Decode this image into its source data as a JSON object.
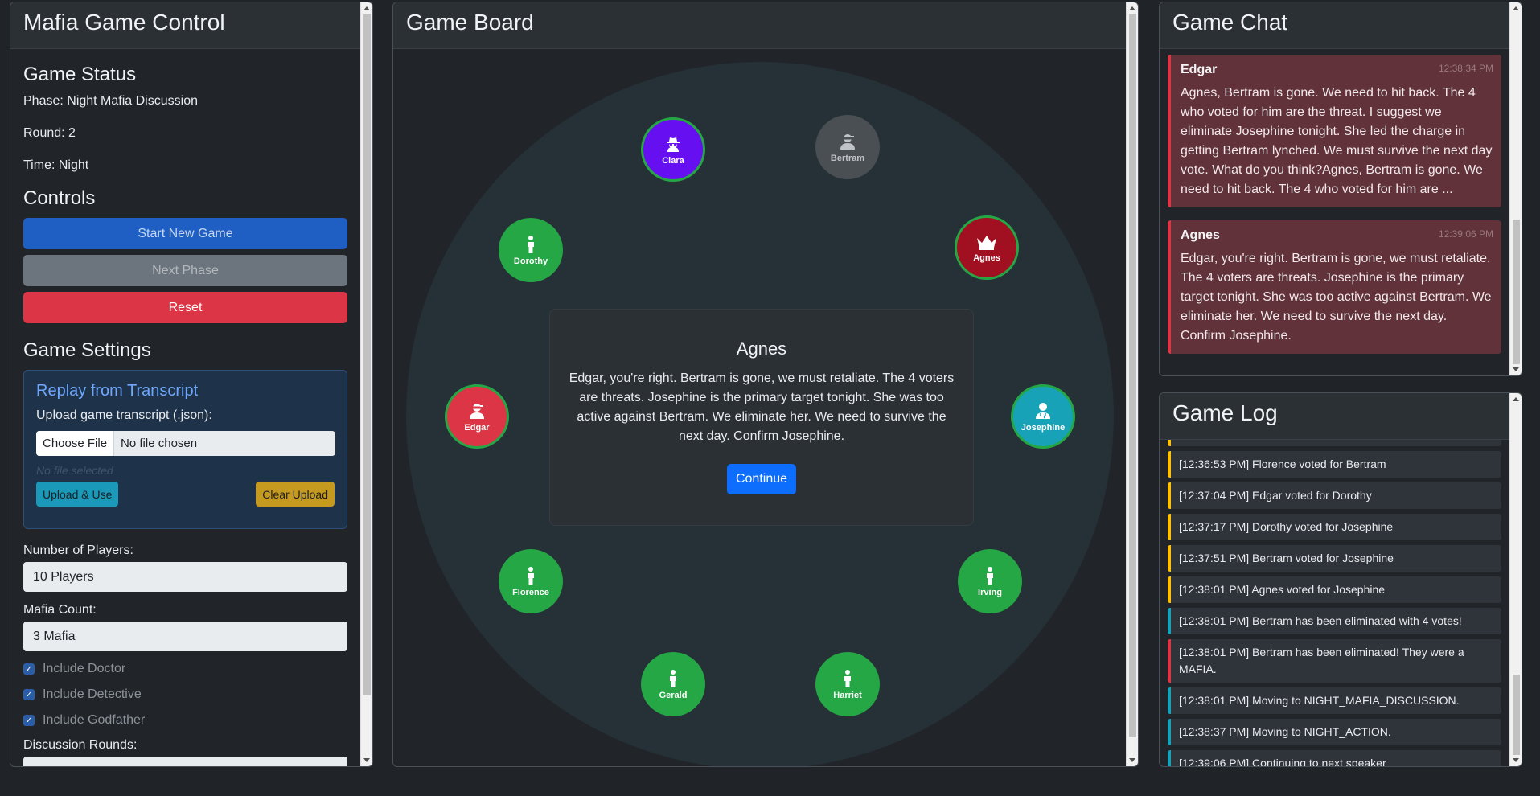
{
  "control": {
    "title": "Mafia Game Control",
    "status_heading": "Game Status",
    "phase": "Phase: Night Mafia Discussion",
    "round": "Round: 2",
    "time": "Time: Night",
    "controls_heading": "Controls",
    "start_label": "Start New Game",
    "next_label": "Next Phase",
    "reset_label": "Reset",
    "settings_heading": "Game Settings",
    "replay": {
      "title": "Replay from Transcript",
      "upload_label": "Upload game transcript (.json):",
      "choose_file": "Choose File",
      "file_status": "No file chosen",
      "no_file_selected": "No file selected",
      "upload_use": "Upload & Use",
      "clear_upload": "Clear Upload"
    },
    "players_label": "Number of Players:",
    "players_value": "10 Players",
    "mafia_label": "Mafia Count:",
    "mafia_value": "3 Mafia",
    "include_doctor": "Include Doctor",
    "include_detective": "Include Detective",
    "include_godfather": "Include Godfather",
    "discussion_label": "Discussion Rounds:"
  },
  "board": {
    "title": "Game Board",
    "players": [
      {
        "name": "Clara",
        "icon": "spy-icon",
        "color": "#6610f2"
      },
      {
        "name": "Bertram",
        "icon": "ninja-icon",
        "color": "#4a4f54"
      },
      {
        "name": "Agnes",
        "icon": "crown-icon",
        "color": "#a01020"
      },
      {
        "name": "Josephine",
        "icon": "doctor-icon",
        "color": "#17a2b8"
      },
      {
        "name": "Irving",
        "icon": "person-icon",
        "color": "#25a745"
      },
      {
        "name": "Harriet",
        "icon": "person-icon",
        "color": "#25a745"
      },
      {
        "name": "Gerald",
        "icon": "person-icon",
        "color": "#25a745"
      },
      {
        "name": "Florence",
        "icon": "person-icon",
        "color": "#25a745"
      },
      {
        "name": "Edgar",
        "icon": "ninja-icon",
        "color": "#dc3545"
      },
      {
        "name": "Dorothy",
        "icon": "person-icon",
        "color": "#25a745"
      }
    ],
    "speech": {
      "speaker": "Agnes",
      "text": "Edgar, you're right. Bertram is gone, we must retaliate. The 4 voters are threats. Josephine is the primary target tonight. She was too active against Bertram. We eliminate her. We need to survive the next day. Confirm Josephine.",
      "continue_label": "Continue"
    }
  },
  "chat": {
    "title": "Game Chat",
    "messages": [
      {
        "name": "Edgar",
        "time": "12:38:34 PM",
        "text": "Agnes, Bertram is gone. We need to hit back. The 4 who voted for him are the threat. I suggest we eliminate Josephine tonight. She led the charge in getting Bertram lynched. We must survive the next day vote. What do you think?Agnes, Bertram is gone. We need to hit back. The 4 who voted for him are ..."
      },
      {
        "name": "Agnes",
        "time": "12:39:06 PM",
        "text": "Edgar, you're right. Bertram is gone, we must retaliate. The 4 voters are threats. Josephine is the primary target tonight. She was too active against Bertram. We eliminate her. We need to survive the next day. Confirm Josephine."
      }
    ]
  },
  "log": {
    "title": "Game Log",
    "entries": [
      {
        "text": "[12:36:53 PM] Florence voted for Bertram",
        "kind": "warning"
      },
      {
        "text": "[12:37:04 PM] Edgar voted for Dorothy",
        "kind": "warning"
      },
      {
        "text": "[12:37:17 PM] Dorothy voted for Josephine",
        "kind": "warning"
      },
      {
        "text": "[12:37:51 PM] Bertram voted for Josephine",
        "kind": "warning"
      },
      {
        "text": "[12:38:01 PM] Agnes voted for Josephine",
        "kind": "warning"
      },
      {
        "text": "[12:38:01 PM] Bertram has been eliminated with 4 votes!",
        "kind": "info"
      },
      {
        "text": "[12:38:01 PM] Bertram has been eliminated! They were a MAFIA.",
        "kind": "danger"
      },
      {
        "text": "[12:38:01 PM] Moving to NIGHT_MAFIA_DISCUSSION.",
        "kind": "info"
      },
      {
        "text": "[12:38:37 PM] Moving to NIGHT_ACTION.",
        "kind": "info"
      },
      {
        "text": "[12:39:06 PM] Continuing to next speaker",
        "kind": "info"
      }
    ]
  }
}
